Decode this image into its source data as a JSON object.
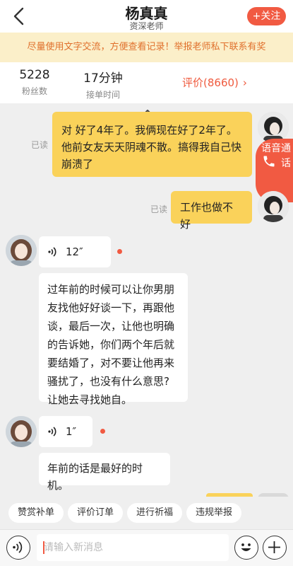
{
  "header": {
    "title": "杨真真",
    "subtitle": "资深老师",
    "follow_label": "+关注"
  },
  "notice": {
    "text": "尽量使用文字交流，方便查看记录！举报老师私下联系有奖"
  },
  "stats": {
    "fans_value": "5228",
    "fans_label": "粉丝数",
    "response_value": "17分钟",
    "response_label": "接单时间",
    "rating_label": "评价(8660)",
    "rating_arrow": "›"
  },
  "voice_call": {
    "label": "语音通话"
  },
  "messages": [
    {
      "side": "right",
      "status": "已读",
      "text": "对 好了4年了。我俩现在好了2年了。他前女友天天阴魂不散。搞得我自己快崩溃了"
    },
    {
      "side": "right",
      "status": "已读",
      "text": "工作也做不好"
    },
    {
      "side": "left",
      "type": "voice",
      "duration": "12″"
    },
    {
      "side": "left",
      "text": "过年前的时候可以让你男朋友找他好好谈一下，再跟他谈，最后一次，让他也明确的告诉她，你们两个年后就要结婚了，对不要让他再来骚扰了，也没有什么意思?让她去寻找她自。"
    },
    {
      "side": "left",
      "type": "voice",
      "duration": "1″"
    },
    {
      "side": "left",
      "text": "年前的话是最好的时机。"
    }
  ],
  "quick_actions": [
    "赞赏补单",
    "评价订单",
    "进行祈福",
    "违规举报"
  ],
  "input": {
    "placeholder": "请输入新消息"
  },
  "icons": {
    "back": "chevron-left-icon",
    "collapse": "chevron-up-icon",
    "voice_call": "phone-icon",
    "voice_message": "sound-wave-icon",
    "voice_input": "voice-input-icon",
    "emoji": "emoji-icon",
    "add": "plus-icon"
  },
  "colors": {
    "accent": "#f15a42",
    "notice_bg": "#fbefc9",
    "notice_text": "#e0702c",
    "my_bubble": "#fad25a",
    "chat_bg": "#efefef"
  }
}
